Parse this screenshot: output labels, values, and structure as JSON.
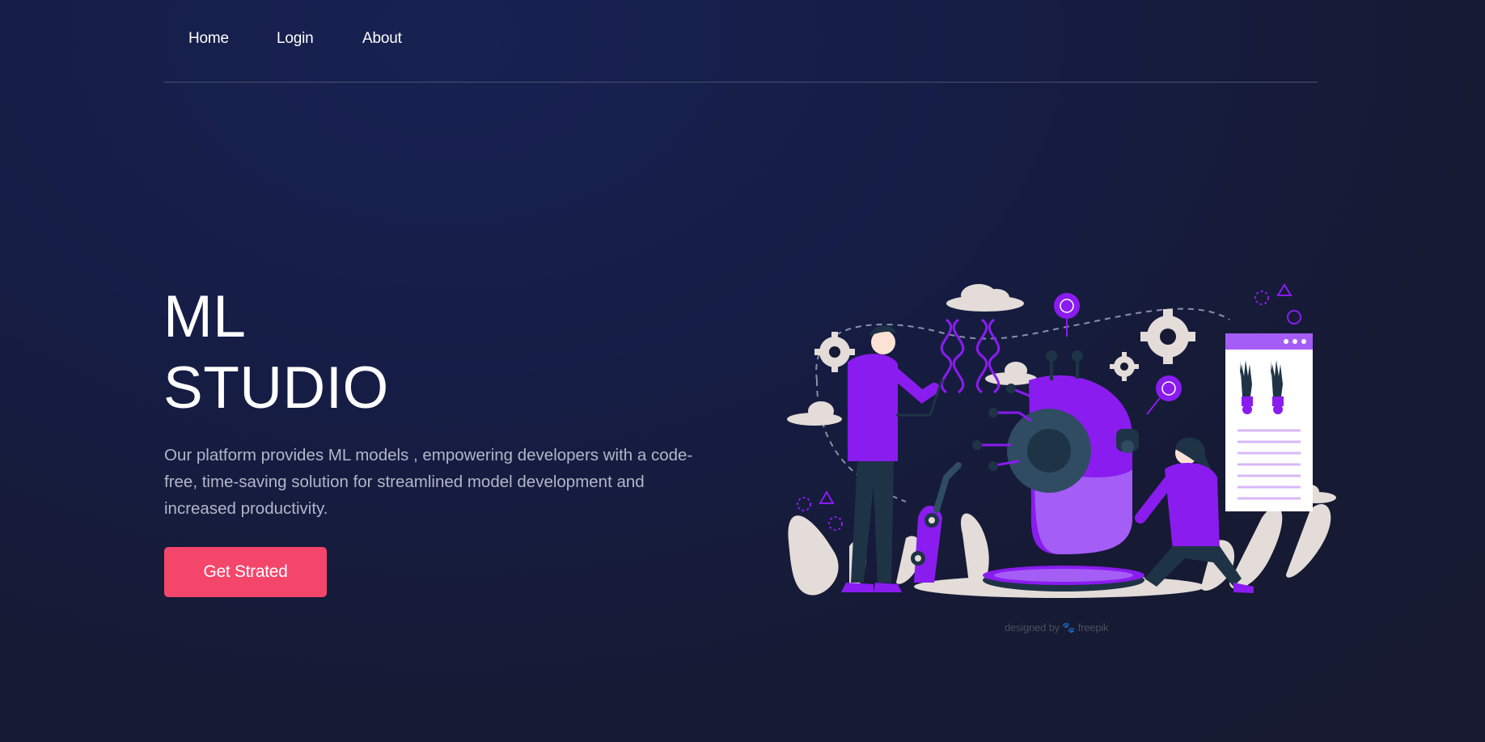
{
  "nav": {
    "items": [
      {
        "label": "Home"
      },
      {
        "label": "Login"
      },
      {
        "label": "About"
      }
    ]
  },
  "hero": {
    "title_line1": "ML",
    "title_line2": "STUDIO",
    "description": "Our platform provides ML models , empowering developers with a code-free, time-saving solution for streamlined model development and increased productivity.",
    "cta_label": "Get Strated"
  },
  "illustration": {
    "credit": "designed by 🐾 freepik"
  },
  "colors": {
    "accent": "#f4456b",
    "purple": "#8a1cf0",
    "dark_teal": "#1f3346"
  }
}
